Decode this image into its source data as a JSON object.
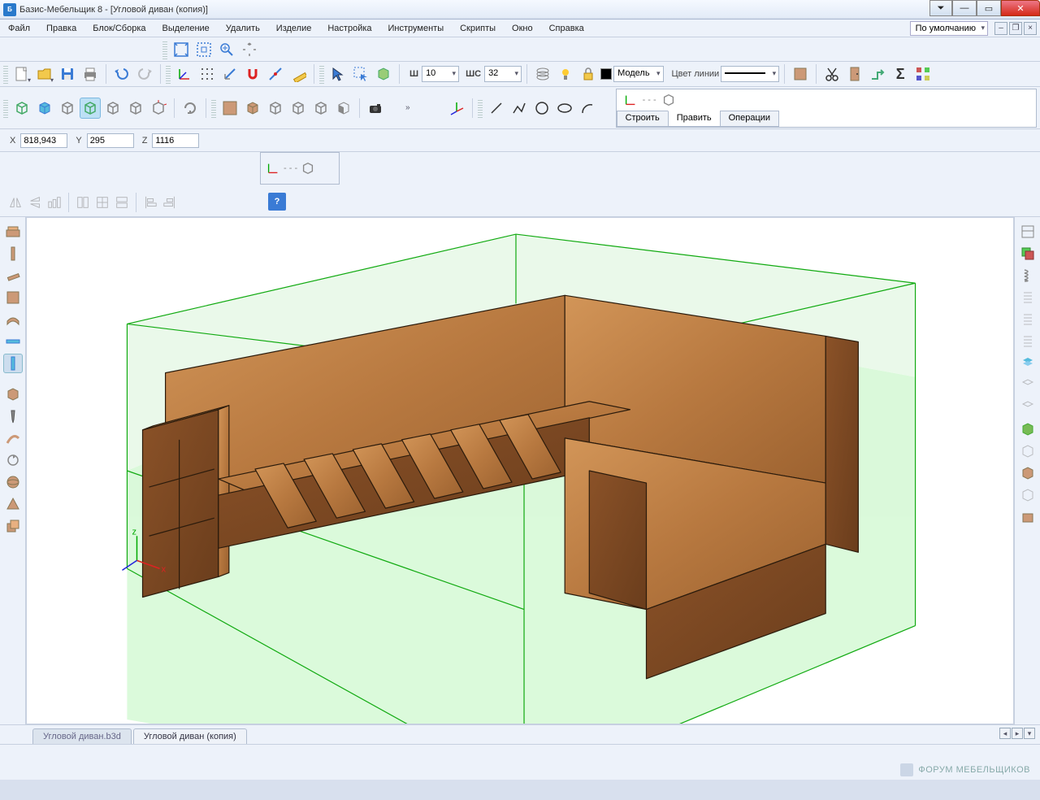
{
  "title": "Базис-Мебельщик 8 - [Угловой диван (копия)]",
  "menu": {
    "file": "Файл",
    "edit": "Правка",
    "block": "Блок/Сборка",
    "selection": "Выделение",
    "delete": "Удалить",
    "product": "Изделие",
    "settings": "Настройка",
    "tools": "Инструменты",
    "scripts": "Скрипты",
    "window": "Окно",
    "help": "Справка",
    "default_mode": "По умолчанию"
  },
  "toolbar": {
    "width_label": "Ш",
    "width_val": "10",
    "step_label": "ШС",
    "step_val": "32",
    "model_label": "Модель",
    "linecolor_label": "Цвет линии"
  },
  "coords": {
    "x_label": "X",
    "x": "818,943",
    "y_label": "Y",
    "y": "295",
    "z_label": "Z",
    "z": "1116"
  },
  "panel_tabs": {
    "build": "Строить",
    "edit": "Править",
    "ops": "Операции"
  },
  "doc_tabs": {
    "tab1": "Угловой диван.b3d",
    "tab2": "Угловой диван (копия)"
  },
  "watermark": "ФОРУМ МЕБЕЛЬЩИКОВ"
}
